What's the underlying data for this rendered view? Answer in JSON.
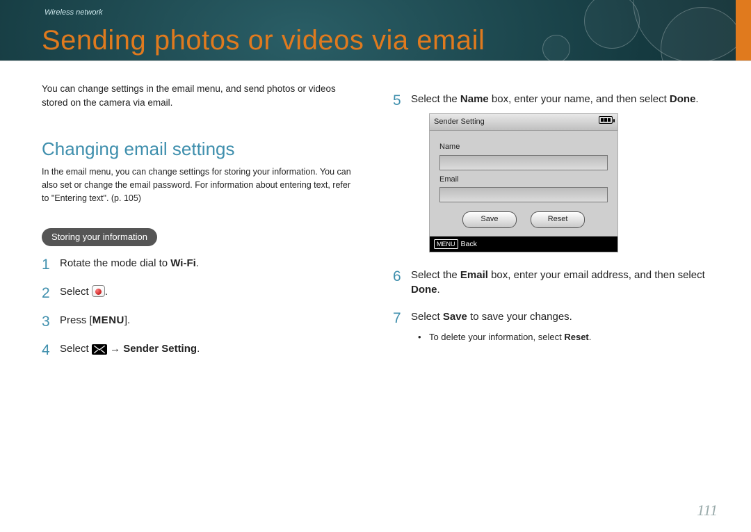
{
  "banner": {
    "breadcrumb": "Wireless network",
    "title": "Sending photos or videos via email"
  },
  "left": {
    "intro": "You can change settings in the email menu, and send photos or videos stored on the camera via email.",
    "section_title": "Changing email settings",
    "section_desc": "In the email menu, you can change settings for storing your information. You can also set or change the email password. For information about entering text, refer to \"Entering text\". (p. 105)",
    "pill": "Storing your information",
    "step1_a": "Rotate the mode dial to ",
    "step1_wifi": "Wi-Fi",
    "step1_b": ".",
    "step2_a": "Select ",
    "step2_b": ".",
    "step3_a": "Press [",
    "step3_menu": "MENU",
    "step3_b": "].",
    "step4_a": "Select ",
    "step4_arrow": " → ",
    "step4_bold": "Sender Setting",
    "step4_b": "."
  },
  "right": {
    "step5_a": "Select the ",
    "step5_name": "Name",
    "step5_b": " box, enter your name, and then select ",
    "step5_done": "Done",
    "step5_c": ".",
    "step6_a": "Select the ",
    "step6_email": "Email",
    "step6_b": " box, enter your email address, and then select ",
    "step6_done": "Done",
    "step6_c": ".",
    "step7_a": "Select ",
    "step7_save": "Save",
    "step7_b": " to save your changes.",
    "step7_sub_a": "To delete your information, select ",
    "step7_sub_reset": "Reset",
    "step7_sub_b": "."
  },
  "device": {
    "title": "Sender Setting",
    "name_label": "Name",
    "email_label": "Email",
    "save_btn": "Save",
    "reset_btn": "Reset",
    "footer_menu": "MENU",
    "footer_back": "Back"
  },
  "page_number": "111"
}
